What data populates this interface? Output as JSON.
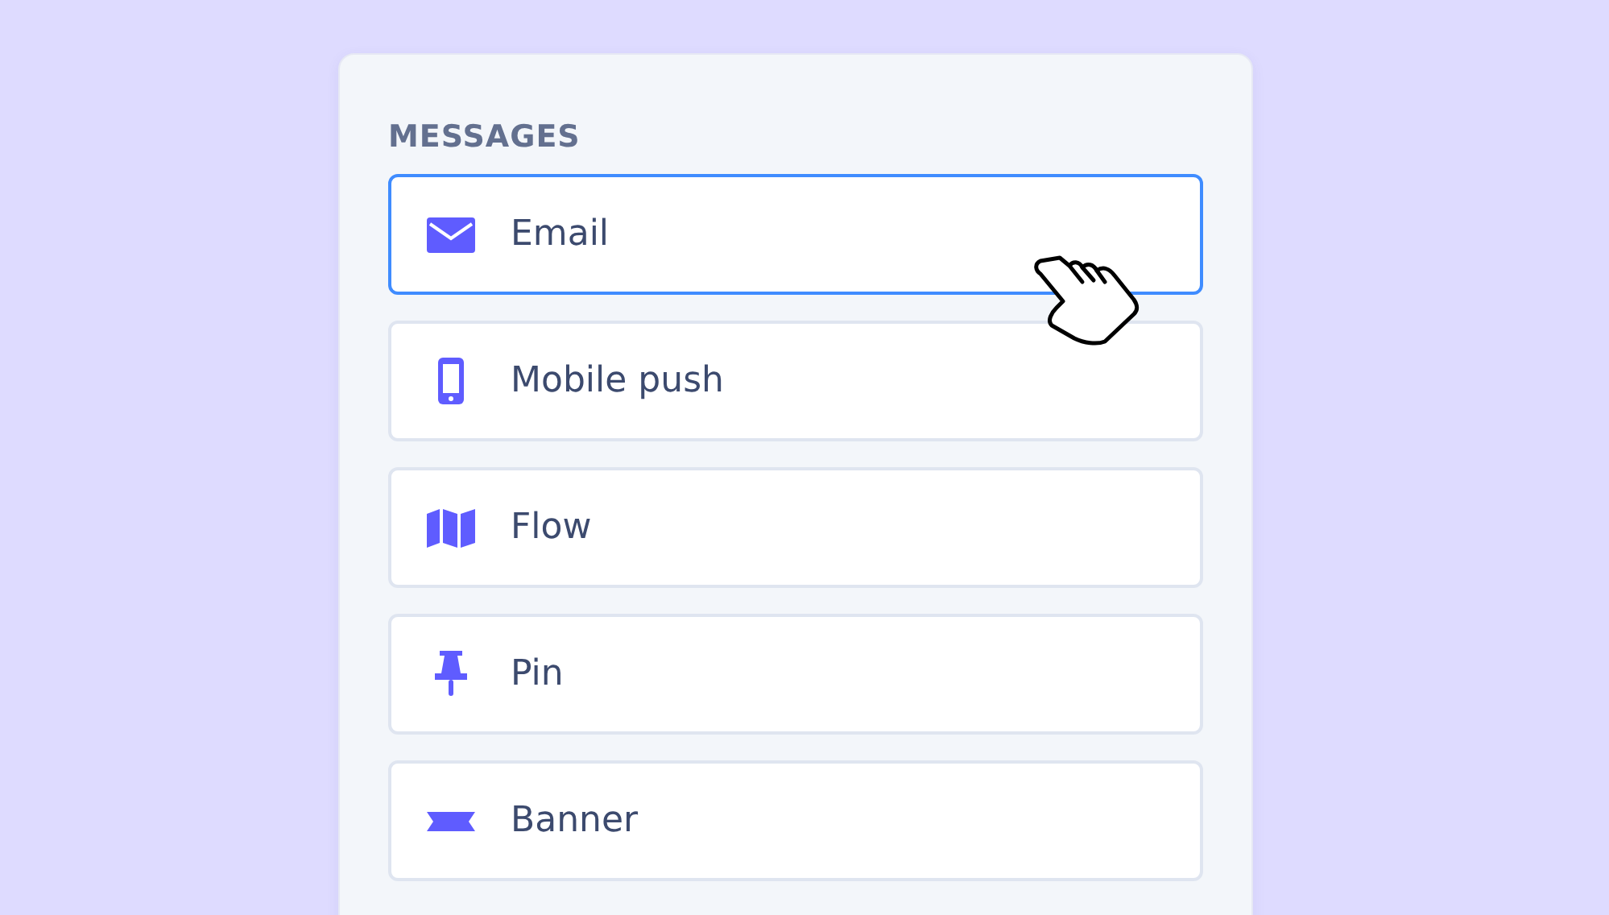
{
  "section": {
    "title": "MESSAGES"
  },
  "items": [
    {
      "label": "Email",
      "kind": "envelope",
      "selected": true
    },
    {
      "label": "Mobile push",
      "kind": "phone",
      "selected": false
    },
    {
      "label": "Flow",
      "kind": "map",
      "selected": false
    },
    {
      "label": "Pin",
      "kind": "pin",
      "selected": false
    },
    {
      "label": "Banner",
      "kind": "banner",
      "selected": false
    }
  ]
}
